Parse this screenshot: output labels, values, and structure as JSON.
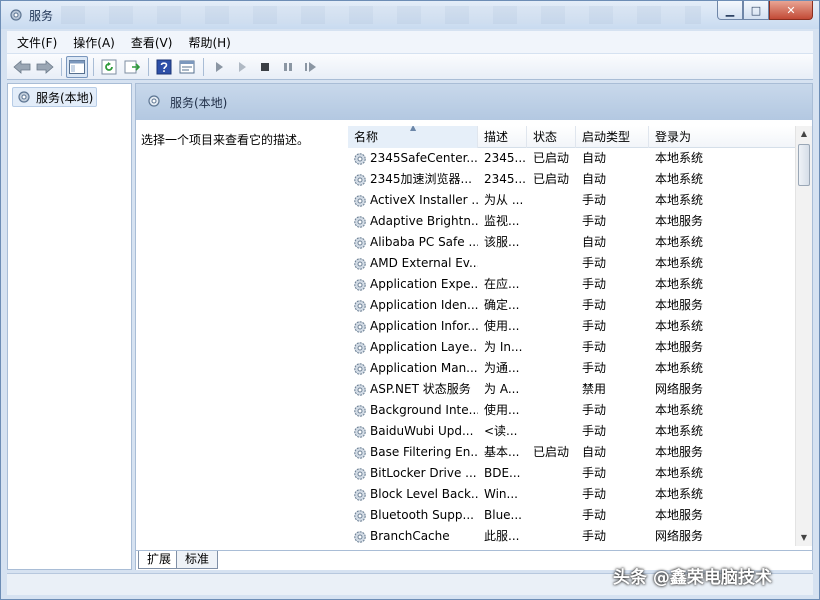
{
  "window": {
    "title": "服务",
    "minimize": "▁",
    "maximize": "□",
    "close": "✕"
  },
  "menu": [
    "文件(F)",
    "操作(A)",
    "查看(V)",
    "帮助(H)"
  ],
  "tree": {
    "root_label": "服务(本地)"
  },
  "panel": {
    "title": "服务(本地)",
    "description_prompt": "选择一个项目来查看它的描述。"
  },
  "list": {
    "columns": [
      "名称",
      "描述",
      "状态",
      "启动类型",
      "登录为"
    ],
    "rows": [
      [
        "2345SafeCenter...",
        "2345...",
        "已启动",
        "自动",
        "本地系统"
      ],
      [
        "2345加速浏览器...",
        "2345...",
        "已启动",
        "自动",
        "本地系统"
      ],
      [
        "ActiveX Installer ...",
        "为从 ...",
        "",
        "手动",
        "本地系统"
      ],
      [
        "Adaptive Brightn...",
        "监视...",
        "",
        "手动",
        "本地服务"
      ],
      [
        "Alibaba PC Safe ...",
        "该服...",
        "",
        "自动",
        "本地系统"
      ],
      [
        "AMD External Ev...",
        "",
        "",
        "手动",
        "本地系统"
      ],
      [
        "Application Expe...",
        "在应...",
        "",
        "手动",
        "本地系统"
      ],
      [
        "Application Iden...",
        "确定...",
        "",
        "手动",
        "本地服务"
      ],
      [
        "Application Infor...",
        "使用...",
        "",
        "手动",
        "本地系统"
      ],
      [
        "Application Laye...",
        "为 In...",
        "",
        "手动",
        "本地服务"
      ],
      [
        "Application Man...",
        "为通...",
        "",
        "手动",
        "本地系统"
      ],
      [
        "ASP.NET 状态服务",
        "为 A...",
        "",
        "禁用",
        "网络服务"
      ],
      [
        "Background Inte...",
        "使用...",
        "",
        "手动",
        "本地系统"
      ],
      [
        "BaiduWubi Upd...",
        "<读...",
        "",
        "手动",
        "本地系统"
      ],
      [
        "Base Filtering En...",
        "基本...",
        "已启动",
        "自动",
        "本地服务"
      ],
      [
        "BitLocker Drive ...",
        "BDE...",
        "",
        "手动",
        "本地系统"
      ],
      [
        "Block Level Back...",
        "Win...",
        "",
        "手动",
        "本地系统"
      ],
      [
        "Bluetooth Supp...",
        "Blue...",
        "",
        "手动",
        "本地服务"
      ],
      [
        "BranchCache",
        "此服...",
        "",
        "手动",
        "网络服务"
      ]
    ]
  },
  "tabs": {
    "extended": "扩展",
    "standard": "标准"
  },
  "watermark": "头条 @鑫荣电脑技术",
  "colors": {
    "header_bg": "#b3c8e1",
    "window_frame": "#d6e2f1"
  }
}
